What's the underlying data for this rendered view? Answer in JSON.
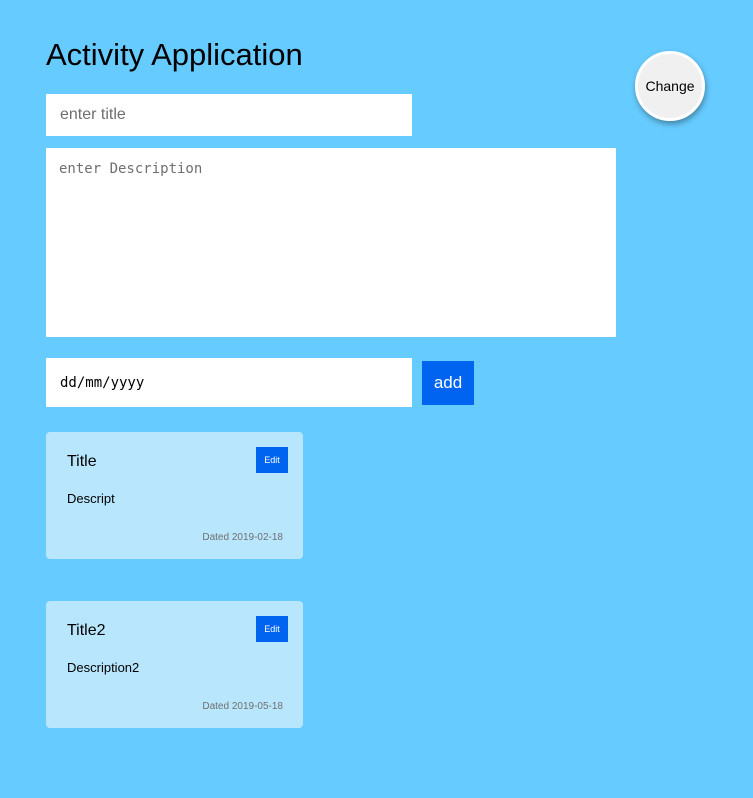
{
  "app": {
    "title": "Activity Application",
    "change_label": "Change"
  },
  "form": {
    "title_placeholder": "enter title",
    "title_value": "",
    "description_placeholder": "enter Description",
    "description_value": "",
    "date_placeholder": "dd/mm/yyyy",
    "add_label": "add"
  },
  "activities": [
    {
      "title": "Title",
      "description": "Descript",
      "date": "Dated 2019-02-18",
      "edit_label": "Edit"
    },
    {
      "title": "Title2",
      "description": "Description2",
      "date": "Dated 2019-05-18",
      "edit_label": "Edit"
    }
  ],
  "colors": {
    "background": "#66cbfe",
    "card": "#b8e6fd",
    "accent": "#0064f0"
  }
}
